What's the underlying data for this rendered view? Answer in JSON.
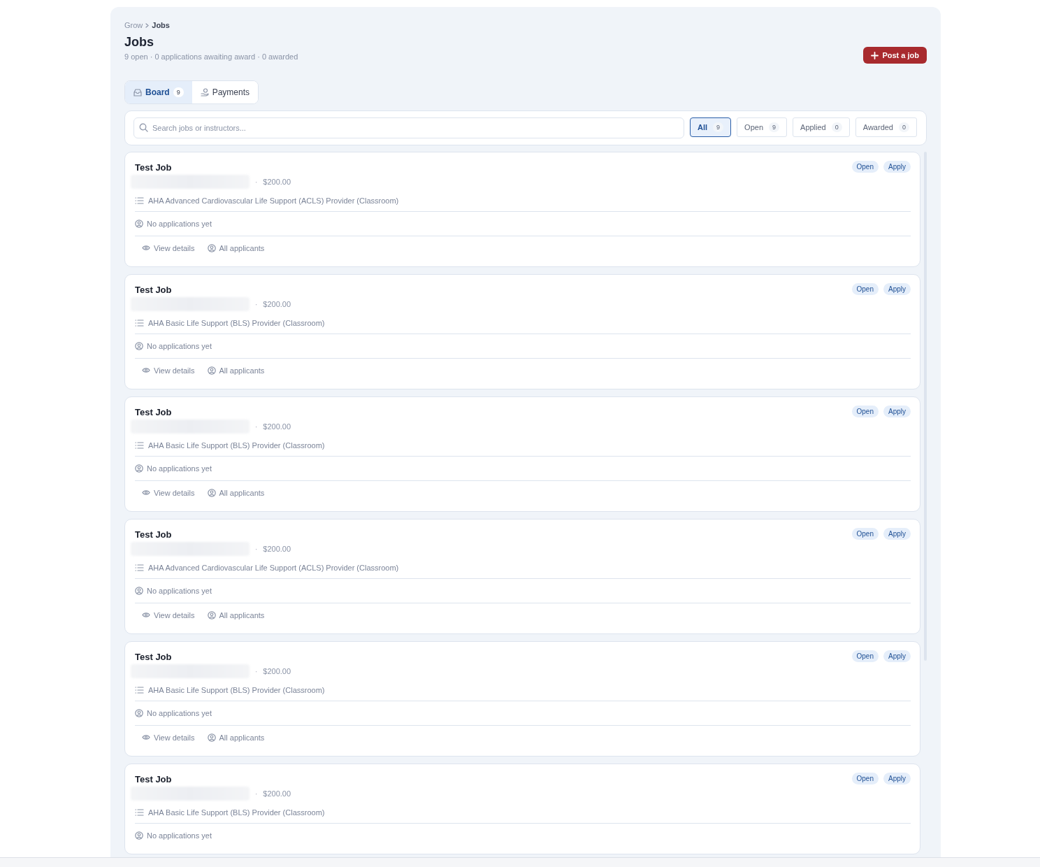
{
  "breadcrumb": [
    {
      "label": "Grow",
      "current": false
    },
    {
      "label": "Jobs",
      "current": true
    }
  ],
  "title": "Jobs",
  "summary": "9 open · 0 applications awaiting award · 0 awarded",
  "post_button": {
    "label": "Post a job"
  },
  "tabs": [
    {
      "label": "Board",
      "count": "9",
      "selected": true
    },
    {
      "label": "Payments",
      "selected": false
    }
  ],
  "search": {
    "placeholder": "Search jobs or instructors..."
  },
  "filters": [
    {
      "label": "All",
      "count": "9",
      "selected": true
    },
    {
      "label": "Open",
      "count": "9",
      "selected": false
    },
    {
      "label": "Applied",
      "count": "0",
      "selected": false
    },
    {
      "label": "Awarded",
      "count": "0",
      "selected": false
    }
  ],
  "jobs": [
    {
      "title": "Test Job",
      "separator": "·",
      "price": "$200.00",
      "course": "AHA Advanced Cardiovascular Life Support (ACLS) Provider (Classroom)",
      "applications": "No applications yet",
      "badges": [
        "Open",
        "Apply"
      ],
      "actions": [
        {
          "label": "View details"
        },
        {
          "label": "All applicants"
        }
      ]
    },
    {
      "title": "Test Job",
      "separator": "·",
      "price": "$200.00",
      "course": "AHA Basic Life Support (BLS) Provider (Classroom)",
      "applications": "No applications yet",
      "badges": [
        "Open",
        "Apply"
      ],
      "actions": [
        {
          "label": "View details"
        },
        {
          "label": "All applicants"
        }
      ]
    },
    {
      "title": "Test Job",
      "separator": "·",
      "price": "$200.00",
      "course": "AHA Basic Life Support (BLS) Provider (Classroom)",
      "applications": "No applications yet",
      "badges": [
        "Open",
        "Apply"
      ],
      "actions": [
        {
          "label": "View details"
        },
        {
          "label": "All applicants"
        }
      ]
    },
    {
      "title": "Test Job",
      "separator": "·",
      "price": "$200.00",
      "course": "AHA Advanced Cardiovascular Life Support (ACLS) Provider (Classroom)",
      "applications": "No applications yet",
      "badges": [
        "Open",
        "Apply"
      ],
      "actions": [
        {
          "label": "View details"
        },
        {
          "label": "All applicants"
        }
      ]
    },
    {
      "title": "Test Job",
      "separator": "·",
      "price": "$200.00",
      "course": "AHA Basic Life Support (BLS) Provider (Classroom)",
      "applications": "No applications yet",
      "badges": [
        "Open",
        "Apply"
      ],
      "actions": [
        {
          "label": "View details"
        },
        {
          "label": "All applicants"
        }
      ]
    },
    {
      "title": "Test Job",
      "separator": "·",
      "price": "$200.00",
      "course": "AHA Basic Life Support (BLS) Provider (Classroom)",
      "applications": "No applications yet",
      "badges": [
        "Open",
        "Apply"
      ]
    }
  ]
}
